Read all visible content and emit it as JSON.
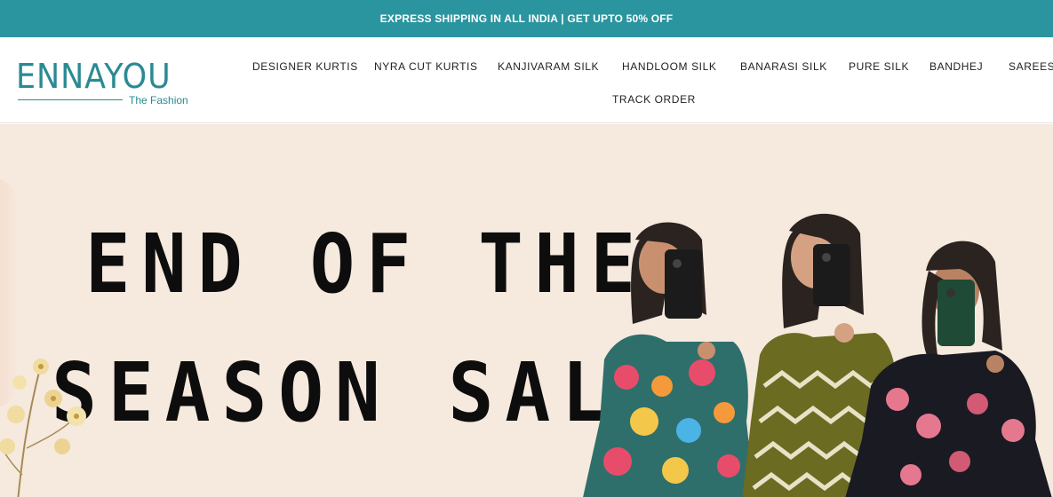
{
  "announcement": {
    "text": "EXPRESS SHIPPING IN ALL INDIA | GET UPTO 50% OFF"
  },
  "logo": {
    "name": "ENNAYOU",
    "tagline": "The Fashion"
  },
  "nav": {
    "items": [
      {
        "label": "DESIGNER KURTIS"
      },
      {
        "label": "NYRA CUT KURTIS"
      },
      {
        "label": "KANJIVARAM SILK"
      },
      {
        "label": "HANDLOOM SILK"
      },
      {
        "label": "BANARASI SILK"
      },
      {
        "label": "PURE SILK"
      },
      {
        "label": "BANDHEJ"
      },
      {
        "label": "SAREES"
      },
      {
        "label": "TRACK ORDER"
      }
    ]
  },
  "hero": {
    "line1": "END OF THE",
    "line2": "SEASON SALE",
    "background_color": "#f6e9dd"
  },
  "colors": {
    "accent": "#2a959f",
    "logo": "#2a8a94"
  }
}
